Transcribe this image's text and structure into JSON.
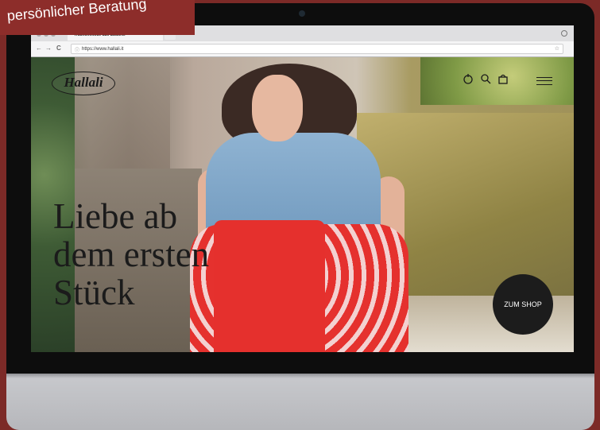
{
  "banner": {
    "text": "persönlicher Beratung"
  },
  "browser": {
    "tab_title": "Trachtenmode aus Südtirol",
    "tab_close": "×",
    "back": "←",
    "forward": "→",
    "reload": "C",
    "url": "https://www.hallali.it",
    "star": "☆"
  },
  "site": {
    "logo_text": "Hallali",
    "icons": [
      "account-icon",
      "search-icon",
      "cart-icon",
      "menu-icon"
    ],
    "headline": [
      "Liebe ab",
      "dem ersten",
      "Stück"
    ],
    "shop_button": "ZUM SHOP"
  },
  "colors": {
    "background": "#7c2a27",
    "banner": "#8d2d2a",
    "bezel": "#0d0d0d",
    "shop_button": "#1c1c1c"
  }
}
